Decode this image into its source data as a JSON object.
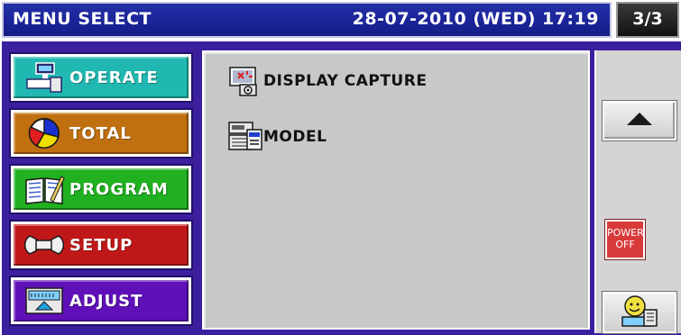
{
  "header": {
    "title": "MENU SELECT",
    "datetime": "28-07-2010 (WED) 17:19",
    "page": "3/3"
  },
  "sidebar": {
    "items": [
      {
        "label": "OPERATE",
        "icon": "register-icon",
        "color": "#20b8b0"
      },
      {
        "label": "TOTAL",
        "icon": "pie-chart-icon",
        "color": "#c07010"
      },
      {
        "label": "PROGRAM",
        "icon": "book-icon",
        "color": "#20b020"
      },
      {
        "label": "SETUP",
        "icon": "wrench-icon",
        "color": "#c01818"
      },
      {
        "label": "ADJUST",
        "icon": "scale-icon",
        "color": "#6010b8"
      }
    ]
  },
  "content": {
    "items": [
      {
        "label": "DISPLAY CAPTURE",
        "icon": "display-camera-icon"
      },
      {
        "label": "MODEL",
        "icon": "model-printer-icon"
      }
    ]
  },
  "right": {
    "up_icon": "up-arrow-icon",
    "power_line1": "POWER",
    "power_line2": "OFF",
    "user_icon": "operator-icon"
  },
  "colors": {
    "title_bar": "#1a2396",
    "frame": "#3b1f9e",
    "content_bg": "#c8c8c8",
    "power": "#d83a3a"
  }
}
